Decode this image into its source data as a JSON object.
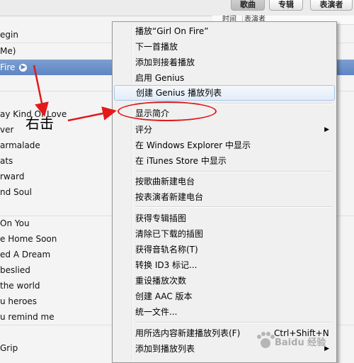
{
  "header": {
    "view_buttons": {
      "songs": "歌曲",
      "albums": "专辑",
      "artists": "表演者"
    },
    "columns": {
      "time": "时间",
      "artist": "表演者"
    }
  },
  "song_list": {
    "rows": [
      "egin",
      "Me)",
      "Fire",
      "",
      "ay Kind Of Love",
      "ver",
      "armalade",
      "ats",
      "rward",
      "nd Soul",
      "",
      "On You",
      "e Home Soon",
      "ed A Dream",
      "beslied",
      " the world",
      "u heroes",
      "u remind me",
      "",
      "Grip"
    ],
    "selected_index": 2
  },
  "context_menu": {
    "items": [
      "播放“Girl On Fire”",
      "下一首播放",
      "添加到接着播放",
      "启用 Genius",
      "创建 Genius 播放列表",
      "显示简介",
      "评分",
      "在 Windows Explorer 中显示",
      "在 iTunes Store 中显示",
      "按歌曲新建电台",
      "按表演者新建电台",
      "获得专辑插图",
      "清除已下载的插图",
      "获得音轨名称(T)",
      "转换 ID3 标记...",
      "重设播放次数",
      "创建 AAC 版本",
      "统一文件...",
      "用所选内容新建播放列表(F)",
      "添加到播放列表"
    ],
    "shortcut": "Ctrl+Shift+N"
  },
  "annotation": {
    "label": "右击",
    "color": "#e21a1a"
  },
  "icons": {
    "submenu": "submenu-arrow-icon",
    "selected_row": "circle-arrow-icon"
  },
  "colors": {
    "selection": "#5d85c4",
    "menu_bg": "#f0f0f0",
    "highlight_border": "#a8c5ea"
  }
}
